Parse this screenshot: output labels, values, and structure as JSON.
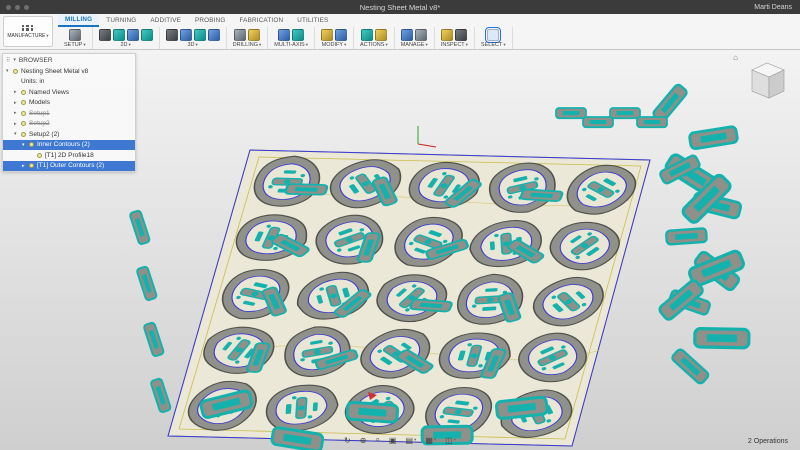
{
  "titlebar": {
    "title": "Nesting Sheet Metal v8*",
    "user": "Marti Deans"
  },
  "workspace": {
    "label": "MANUFACTURE"
  },
  "tabs": [
    {
      "label": "MILLING",
      "active": true
    },
    {
      "label": "TURNING",
      "active": false
    },
    {
      "label": "ADDITIVE",
      "active": false
    },
    {
      "label": "PROBING",
      "active": false
    },
    {
      "label": "FABRICATION",
      "active": false
    },
    {
      "label": "UTILITIES",
      "active": false
    }
  ],
  "toolbar_groups": [
    {
      "label": "SETUP"
    },
    {
      "label": "2D"
    },
    {
      "label": "3D"
    },
    {
      "label": "DRILLING"
    },
    {
      "label": "MULTI-AXIS"
    },
    {
      "label": "MODIFY"
    },
    {
      "label": "ACTIONS"
    },
    {
      "label": "MANAGE"
    },
    {
      "label": "INSPECT"
    },
    {
      "label": "SELECT"
    }
  ],
  "browser": {
    "header": "BROWSER",
    "items": [
      {
        "label": "Nesting Sheet Metal v8"
      },
      {
        "label": "Units: in"
      },
      {
        "label": "Named Views"
      },
      {
        "label": "Models"
      },
      {
        "label": "Setup1"
      },
      {
        "label": "Setup2"
      },
      {
        "label": "Setup2 (2)"
      },
      {
        "label": "Inner Contours (2)"
      },
      {
        "label": "[T1] 2D Profile18"
      },
      {
        "label": "[T1] Outer Contours (2)"
      }
    ]
  },
  "statusbar": {
    "operations": "2 Operations"
  },
  "icons": {
    "caret": "▾",
    "expander_open": "▾",
    "expander_closed": "▸",
    "grip": "⠿",
    "home": "⌂",
    "orbit": "↻",
    "pan": "⊕",
    "zoom": "⌕",
    "fit": "▣",
    "display": "▤",
    "grid": "▦",
    "viewports": "◫"
  },
  "colors": {
    "accent": "#1a73c0",
    "selection": "#3e78d2",
    "toolpath_teal": "#15b2ad",
    "contour_blue": "#3b3bd0",
    "sheet": "#ebe8d8"
  }
}
